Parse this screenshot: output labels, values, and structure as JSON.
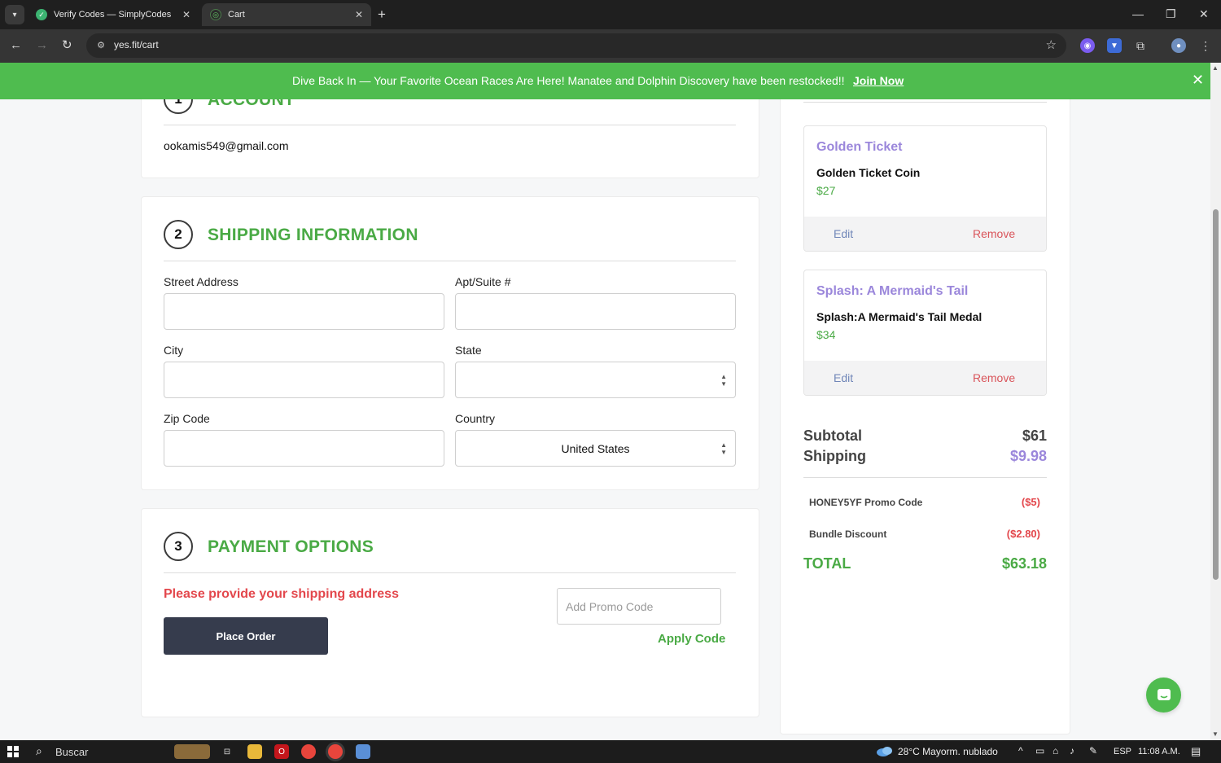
{
  "browser": {
    "tabs": [
      {
        "title": "Verify Codes — SimplyCodes",
        "icon": "simplycodes-check-icon"
      },
      {
        "title": "Cart",
        "icon": "yesfit-icon"
      }
    ],
    "url": "yes.fit/cart"
  },
  "banner": {
    "text": "Dive Back In — Your Favorite Ocean Races Are Here! Manatee and Dolphin Discovery have been restocked!!",
    "link": "Join Now",
    "color": "#4fbc4f"
  },
  "account": {
    "step": "1",
    "title": "ACCOUNT",
    "email": "ookamis549@gmail.com"
  },
  "shipping": {
    "step": "2",
    "title": "SHIPPING INFORMATION",
    "street_label": "Street Address",
    "apt_label": "Apt/Suite #",
    "city_label": "City",
    "state_label": "State",
    "zip_label": "Zip Code",
    "country_label": "Country",
    "country_value": "United States"
  },
  "payment": {
    "step": "3",
    "title": "PAYMENT OPTIONS",
    "error": "Please provide your shipping address",
    "place_order": "Place Order",
    "promo_placeholder": "Add Promo Code",
    "apply_code": "Apply Code"
  },
  "cart": {
    "items": [
      {
        "title": "Golden Ticket",
        "name": "Golden Ticket Coin",
        "price": "$27",
        "edit": "Edit",
        "remove": "Remove"
      },
      {
        "title": "Splash: A Mermaid's Tail",
        "name": "Splash:A Mermaid's Tail Medal",
        "price": "$34",
        "edit": "Edit",
        "remove": "Remove"
      }
    ],
    "subtotal_label": "Subtotal",
    "subtotal": "$61",
    "shipping_label": "Shipping",
    "shipping": "$9.98",
    "promo_label": "HONEY5YF Promo Code",
    "promo_value": "($5)",
    "bundle_label": "Bundle Discount",
    "bundle_value": "($2.80)",
    "total_label": "TOTAL",
    "total": "$63.18"
  },
  "taskbar": {
    "search": "Buscar",
    "weather": "28°C  Mayorm. nublado",
    "lang": "ESP",
    "time": "11:08 A.M."
  },
  "colors": {
    "accent_green": "#4aaa45",
    "error_red": "#e3474c",
    "item_title_purple": "#9b87db",
    "button_dark": "#363c4d"
  }
}
